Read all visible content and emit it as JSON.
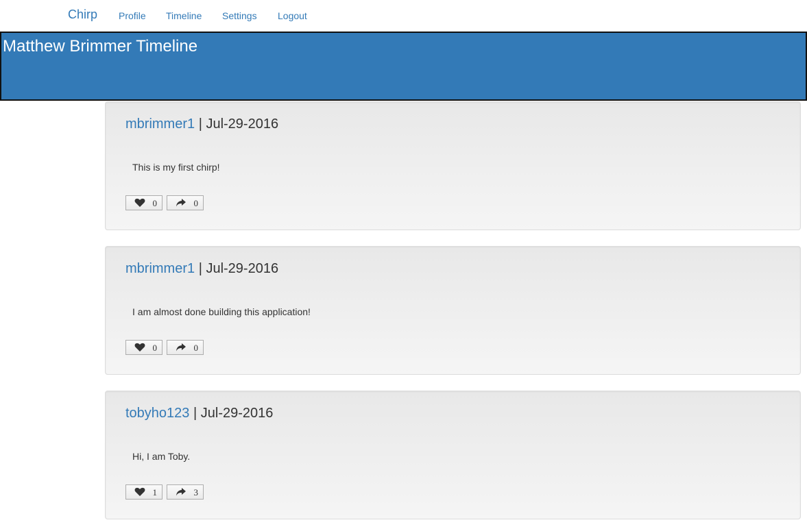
{
  "nav": {
    "brand": "Chirp",
    "links": [
      "Profile",
      "Timeline",
      "Settings",
      "Logout"
    ]
  },
  "banner": {
    "title": "Matthew Brimmer Timeline"
  },
  "posts": [
    {
      "user": "mbrimmer1",
      "separator": "|",
      "date": "Jul-29-2016",
      "text": "This is my first chirp!",
      "likes": "0",
      "shares": "0"
    },
    {
      "user": "mbrimmer1",
      "separator": "|",
      "date": "Jul-29-2016",
      "text": "I am almost done building this application!",
      "likes": "0",
      "shares": "0"
    },
    {
      "user": "tobyho123",
      "separator": "|",
      "date": "Jul-29-2016",
      "text": "Hi, I am Toby.",
      "likes": "1",
      "shares": "3"
    }
  ],
  "icons": {
    "like": "heart-icon",
    "share": "share-arrow-icon"
  },
  "colors": {
    "accent": "#337ab7",
    "banner_border": "#111111",
    "text": "#333333"
  }
}
